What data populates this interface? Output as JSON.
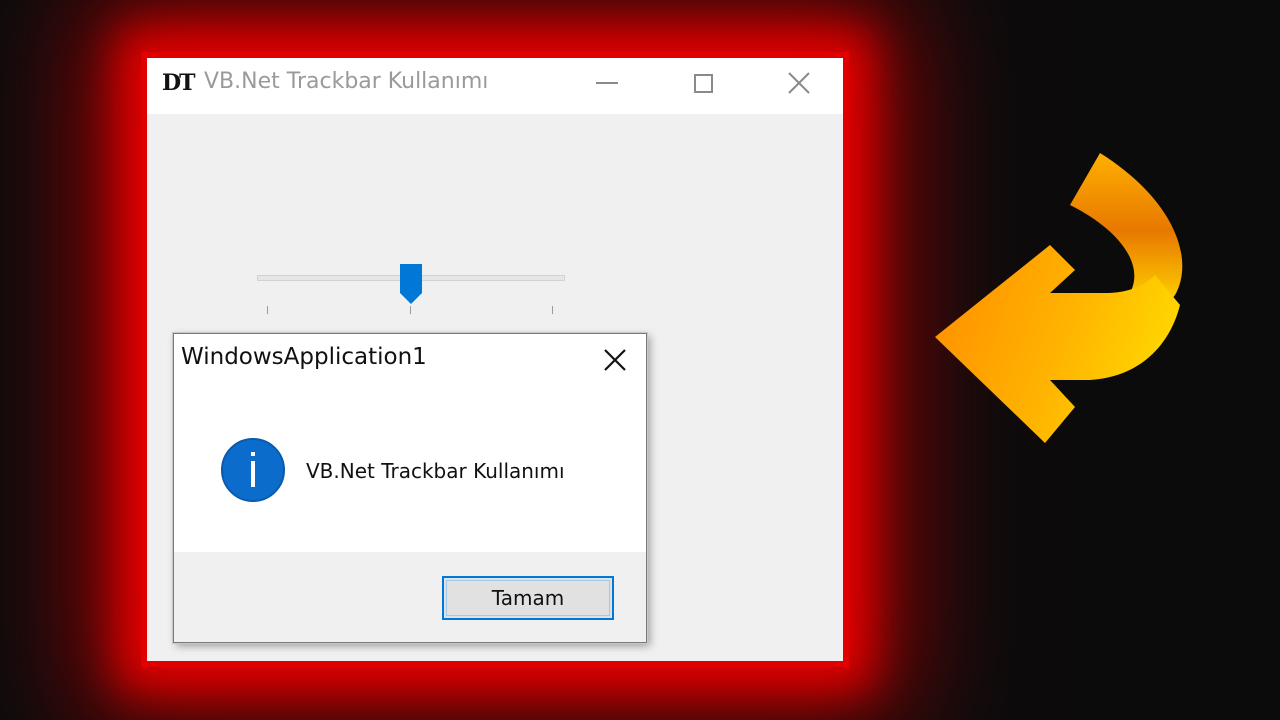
{
  "main_window": {
    "icon_text": "DT",
    "title": "VB.Net Trackbar Kullanımı",
    "trackbar": {
      "value": 5,
      "min": 0,
      "max": 10
    }
  },
  "message_box": {
    "title": "WindowsApplication1",
    "message": "VB.Net Trackbar Kullanımı",
    "ok_label": "Tamam",
    "icon": "info-icon"
  },
  "colors": {
    "accent": "#0078d7",
    "glow": "#e00000",
    "arrow": "#ffa500"
  }
}
